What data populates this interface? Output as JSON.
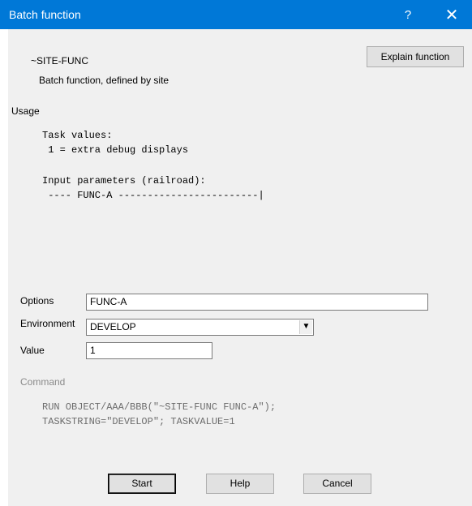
{
  "window": {
    "title": "Batch function",
    "help_glyph": "?",
    "close_glyph": "✕"
  },
  "header": {
    "function_name": "~SITE-FUNC",
    "description": "Batch function, defined by site",
    "explain_button": "Explain function"
  },
  "usage": {
    "heading": "Usage",
    "lines": [
      "Task values:",
      " 1 = extra debug displays",
      "",
      "Input parameters (railroad):",
      " ---- FUNC-A ------------------------|"
    ]
  },
  "form": {
    "options_label": "Options",
    "options_value": "FUNC-A",
    "environment_label": "Environment",
    "environment_value": "DEVELOP",
    "value_label": "Value",
    "value_value": "1"
  },
  "command": {
    "heading": "Command",
    "line1": "RUN OBJECT/AAA/BBB(\"~SITE-FUNC FUNC-A\");",
    "line2": "TASKSTRING=\"DEVELOP\"; TASKVALUE=1"
  },
  "buttons": {
    "start": "Start",
    "help": "Help",
    "cancel": "Cancel"
  },
  "colors": {
    "titlebar": "#0078d7",
    "dialog_bg": "#f0f0f0"
  }
}
